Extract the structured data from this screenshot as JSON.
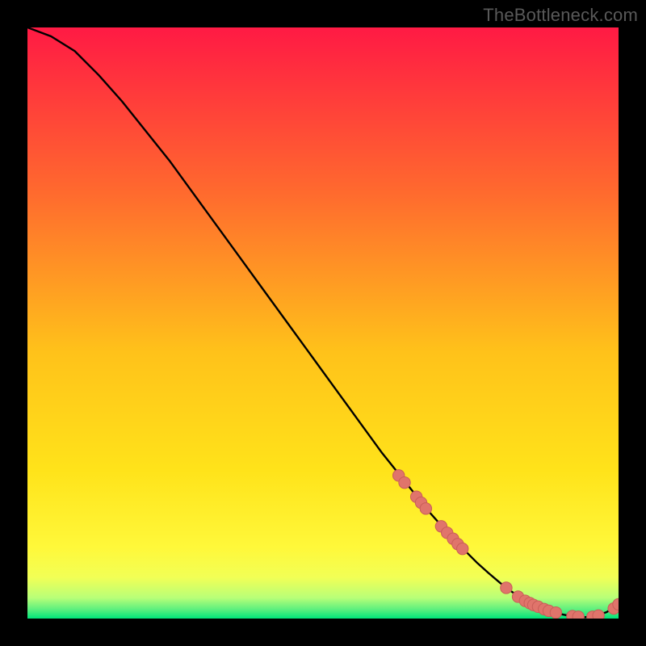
{
  "watermark": "TheBottleneck.com",
  "colors": {
    "gradient_top": "#ff1a44",
    "gradient_upper_mid": "#ff8a2a",
    "gradient_mid": "#ffe11a",
    "gradient_lower_mid": "#f8ff4a",
    "gradient_low": "#d8ff7a",
    "gradient_bottom": "#00e47a",
    "curve": "#000000",
    "marker_fill": "#e0746b",
    "marker_stroke": "#c95e58",
    "background": "#000000"
  },
  "chart_data": {
    "type": "line",
    "title": "",
    "xlabel": "",
    "ylabel": "",
    "xlim": [
      0,
      100
    ],
    "ylim": [
      0,
      100
    ],
    "grid": false,
    "legend": false,
    "series": [
      {
        "name": "bottleneck-curve",
        "x": [
          0,
          4,
          8,
          12,
          16,
          20,
          24,
          28,
          32,
          36,
          40,
          44,
          48,
          52,
          56,
          60,
          64,
          68,
          72,
          76,
          78,
          80,
          82,
          84,
          86,
          88,
          90,
          92,
          94,
          96,
          98,
          100
        ],
        "y": [
          100,
          98.5,
          96,
          92,
          87.5,
          82.5,
          77.5,
          72,
          66.5,
          61,
          55.5,
          50,
          44.5,
          39,
          33.5,
          28,
          23,
          18,
          13.5,
          9.5,
          7.7,
          6.0,
          4.5,
          3.2,
          2.2,
          1.4,
          0.8,
          0.4,
          0.2,
          0.4,
          1.1,
          2.4
        ]
      }
    ],
    "markers": [
      {
        "x": 62.8,
        "y": 24.2
      },
      {
        "x": 63.8,
        "y": 23.0
      },
      {
        "x": 65.8,
        "y": 20.6
      },
      {
        "x": 66.6,
        "y": 19.6
      },
      {
        "x": 67.4,
        "y": 18.6
      },
      {
        "x": 70.0,
        "y": 15.6
      },
      {
        "x": 71.0,
        "y": 14.5
      },
      {
        "x": 72.0,
        "y": 13.5
      },
      {
        "x": 72.8,
        "y": 12.6
      },
      {
        "x": 73.6,
        "y": 11.8
      },
      {
        "x": 81.0,
        "y": 5.2
      },
      {
        "x": 83.0,
        "y": 3.7
      },
      {
        "x": 84.2,
        "y": 3.0
      },
      {
        "x": 85.0,
        "y": 2.6
      },
      {
        "x": 85.6,
        "y": 2.3
      },
      {
        "x": 86.4,
        "y": 2.0
      },
      {
        "x": 87.4,
        "y": 1.6
      },
      {
        "x": 88.2,
        "y": 1.3
      },
      {
        "x": 89.4,
        "y": 1.0
      },
      {
        "x": 92.2,
        "y": 0.4
      },
      {
        "x": 93.2,
        "y": 0.3
      },
      {
        "x": 95.6,
        "y": 0.3
      },
      {
        "x": 96.6,
        "y": 0.5
      },
      {
        "x": 99.2,
        "y": 1.7
      },
      {
        "x": 100.0,
        "y": 2.4
      }
    ]
  }
}
